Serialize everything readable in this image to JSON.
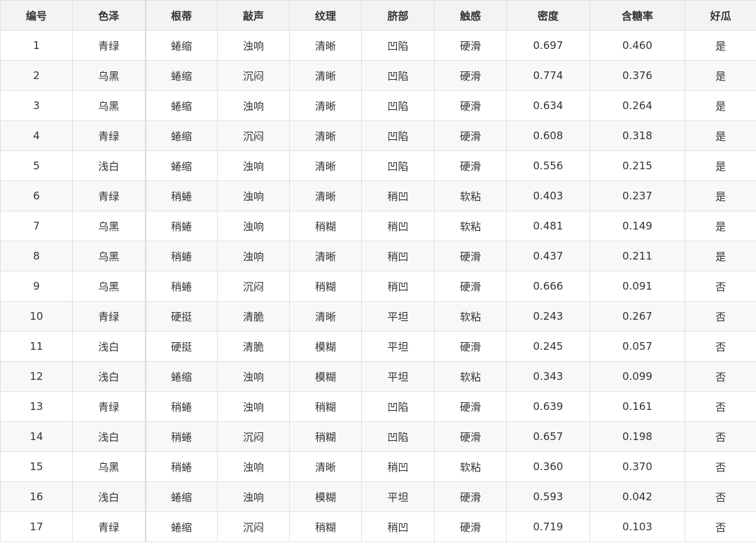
{
  "table": {
    "headers": [
      "编号",
      "色泽",
      "根蒂",
      "敲声",
      "纹理",
      "脐部",
      "触感",
      "密度",
      "含糖率",
      "好瓜"
    ],
    "rows": [
      [
        "1",
        "青绿",
        "蜷缩",
        "浊响",
        "清晰",
        "凹陷",
        "硬滑",
        "0.697",
        "0.460",
        "是"
      ],
      [
        "2",
        "乌黑",
        "蜷缩",
        "沉闷",
        "清晰",
        "凹陷",
        "硬滑",
        "0.774",
        "0.376",
        "是"
      ],
      [
        "3",
        "乌黑",
        "蜷缩",
        "浊响",
        "清晰",
        "凹陷",
        "硬滑",
        "0.634",
        "0.264",
        "是"
      ],
      [
        "4",
        "青绿",
        "蜷缩",
        "沉闷",
        "清晰",
        "凹陷",
        "硬滑",
        "0.608",
        "0.318",
        "是"
      ],
      [
        "5",
        "浅白",
        "蜷缩",
        "浊响",
        "清晰",
        "凹陷",
        "硬滑",
        "0.556",
        "0.215",
        "是"
      ],
      [
        "6",
        "青绿",
        "稍蜷",
        "浊响",
        "清晰",
        "稍凹",
        "软粘",
        "0.403",
        "0.237",
        "是"
      ],
      [
        "7",
        "乌黑",
        "稍蜷",
        "浊响",
        "稍糊",
        "稍凹",
        "软粘",
        "0.481",
        "0.149",
        "是"
      ],
      [
        "8",
        "乌黑",
        "稍蜷",
        "浊响",
        "清晰",
        "稍凹",
        "硬滑",
        "0.437",
        "0.211",
        "是"
      ],
      [
        "9",
        "乌黑",
        "稍蜷",
        "沉闷",
        "稍糊",
        "稍凹",
        "硬滑",
        "0.666",
        "0.091",
        "否"
      ],
      [
        "10",
        "青绿",
        "硬挺",
        "清脆",
        "清晰",
        "平坦",
        "软粘",
        "0.243",
        "0.267",
        "否"
      ],
      [
        "11",
        "浅白",
        "硬挺",
        "清脆",
        "模糊",
        "平坦",
        "硬滑",
        "0.245",
        "0.057",
        "否"
      ],
      [
        "12",
        "浅白",
        "蜷缩",
        "浊响",
        "模糊",
        "平坦",
        "软粘",
        "0.343",
        "0.099",
        "否"
      ],
      [
        "13",
        "青绿",
        "稍蜷",
        "浊响",
        "稍糊",
        "凹陷",
        "硬滑",
        "0.639",
        "0.161",
        "否"
      ],
      [
        "14",
        "浅白",
        "稍蜷",
        "沉闷",
        "稍糊",
        "凹陷",
        "硬滑",
        "0.657",
        "0.198",
        "否"
      ],
      [
        "15",
        "乌黑",
        "稍蜷",
        "浊响",
        "清晰",
        "稍凹",
        "软粘",
        "0.360",
        "0.370",
        "否"
      ],
      [
        "16",
        "浅白",
        "蜷缩",
        "浊响",
        "模糊",
        "平坦",
        "硬滑",
        "0.593",
        "0.042",
        "否"
      ],
      [
        "17",
        "青绿",
        "蜷缩",
        "沉闷",
        "稍糊",
        "稍凹",
        "硬滑",
        "0.719",
        "0.103",
        "否"
      ]
    ]
  }
}
